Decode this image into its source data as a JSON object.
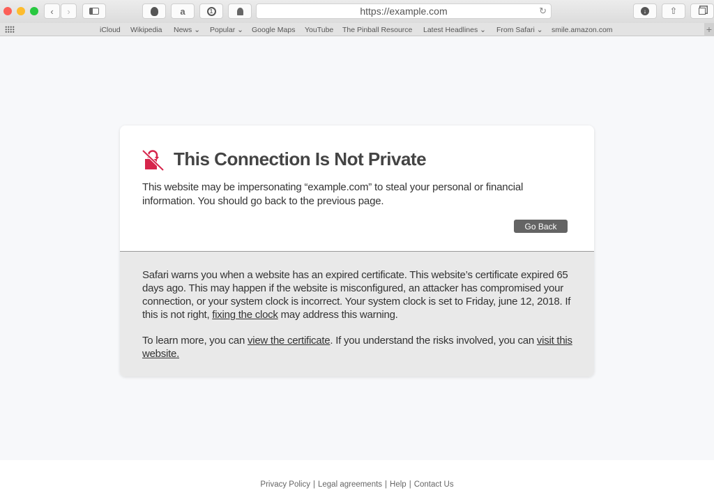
{
  "browser": {
    "url": "https://example.com",
    "toolbar_extensions": [
      "ghostery-icon",
      "amazon-icon",
      "1password-icon",
      "ghost-icon"
    ],
    "bookmarks": [
      {
        "label": "iCloud",
        "dropdown": false
      },
      {
        "label": "Wikipedia",
        "dropdown": false
      },
      {
        "label": "News",
        "dropdown": true
      },
      {
        "label": "Popular",
        "dropdown": true
      },
      {
        "label": "Google Maps",
        "dropdown": false
      },
      {
        "label": "YouTube",
        "dropdown": false
      },
      {
        "label": "The Pinball Resource",
        "dropdown": false
      },
      {
        "label": "Latest Headlines",
        "dropdown": true
      },
      {
        "label": "From Safari",
        "dropdown": true
      },
      {
        "label": "smile.amazon.com",
        "dropdown": false
      }
    ],
    "chevron": "⌄"
  },
  "warning": {
    "title": "This Connection Is Not Private",
    "description": "This website may be impersonating “example.com” to steal your personal or financial information. You should go back to the previous page.",
    "go_back_label": "Go Back",
    "accent_color": "#d6254b",
    "details_p1_before": "Safari warns you when a website has an expired certificate. This website’s certificate expired 65 days ago. This may happen if the website is misconfigured, an attacker has compromised your connection, or your system clock is incorrect. Your system clock is set to Friday, june 12, 2018. If this is not right, ",
    "details_p1_link": "fixing the clock",
    "details_p1_after": " may address this warning.",
    "details_p2_before": "To learn more, you can ",
    "details_p2_link1": "view the certificate",
    "details_p2_middle": ". If you understand the risks involved, you can ",
    "details_p2_link2": "visit this website."
  },
  "footer": {
    "links": [
      "Privacy Policy",
      "Legal agreements",
      "Help",
      "Contact Us"
    ],
    "separator": "|"
  }
}
